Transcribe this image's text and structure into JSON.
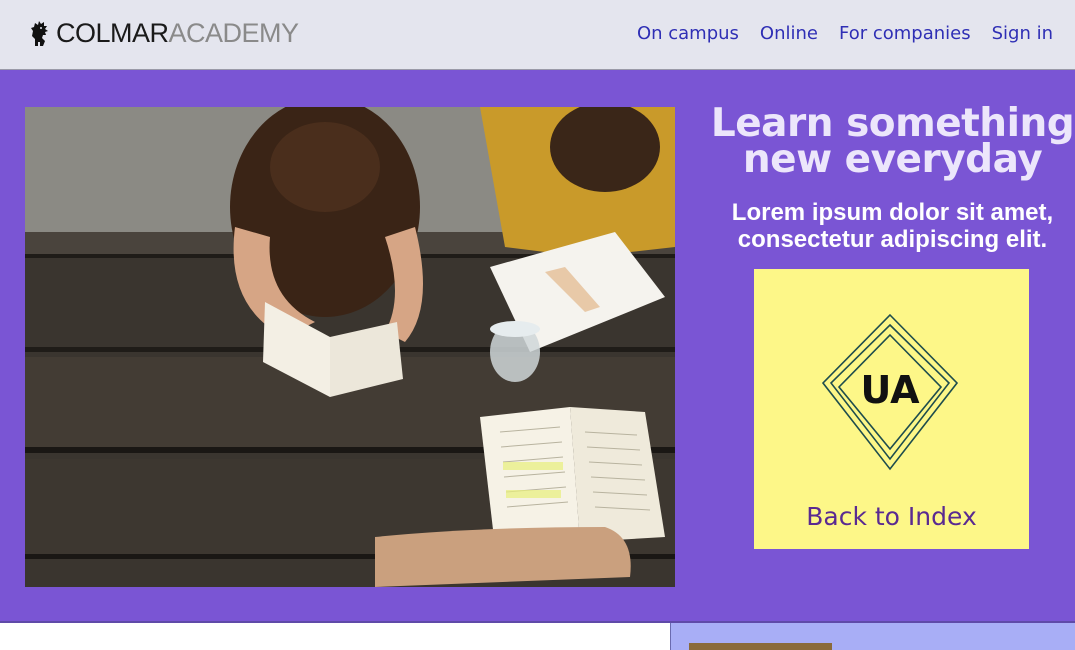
{
  "header": {
    "brand_primary": "COLMAR",
    "brand_secondary": "ACADEMY",
    "nav": [
      {
        "label": "On campus"
      },
      {
        "label": "Online"
      },
      {
        "label": "For companies"
      },
      {
        "label": "Sign in"
      }
    ]
  },
  "hero": {
    "headline_line1": "Learn something",
    "headline_line2": "new everyday",
    "subtitle": "Lorem ipsum dolor sit amet, consectetur adipiscing elit.",
    "card": {
      "logo_text": "UA",
      "link_label": "Back to Index"
    }
  },
  "colors": {
    "hero_bg": "#7a55d4",
    "header_bg": "#e4e5ee",
    "nav_link": "#2f2fb5",
    "card_bg": "#fdf788",
    "card_link": "#5a2a91"
  }
}
